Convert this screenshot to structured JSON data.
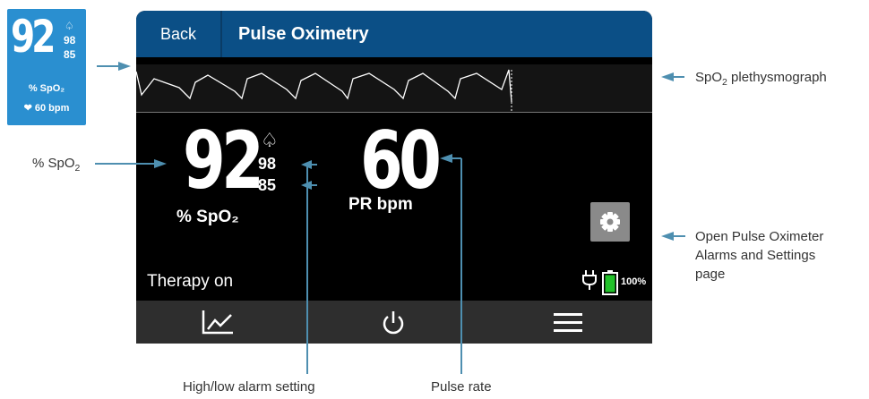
{
  "thumbnail": {
    "spo2_value": "92",
    "alarm_high": "98",
    "alarm_low": "85",
    "spo2_unit": "% SpO₂",
    "pulse_text": "60 bpm"
  },
  "header": {
    "back_label": "Back",
    "title": "Pulse Oximetry"
  },
  "readings": {
    "spo2_value": "92",
    "alarm_high": "98",
    "alarm_low": "85",
    "spo2_unit": "% SpO₂",
    "pulse_rate_value": "60",
    "pulse_rate_unit": "PR bpm"
  },
  "status_bar": {
    "therapy_text": "Therapy on",
    "battery_percent": "100%"
  },
  "nav": {
    "items": [
      "chart-icon",
      "power-icon",
      "menu-icon"
    ]
  },
  "callouts": {
    "pleth_label_prefix": "SpO",
    "pleth_label_sub": "2",
    "pleth_label_suffix": " plethysmograph",
    "spo2_label_prefix": "% SpO",
    "spo2_label_sub": "2",
    "settings_line1": "Open Pulse Oximeter",
    "settings_line2": "Alarms and Settings",
    "settings_line3": "page",
    "alarm_setting": "High/low alarm setting",
    "pulse_rate": "Pulse rate"
  },
  "colors": {
    "header": "#0b4f86",
    "thumbnail": "#2a8fd0",
    "callout_arrow": "#4e8fb0",
    "battery": "#22c22a",
    "gear_button": "#8a8a8a"
  }
}
